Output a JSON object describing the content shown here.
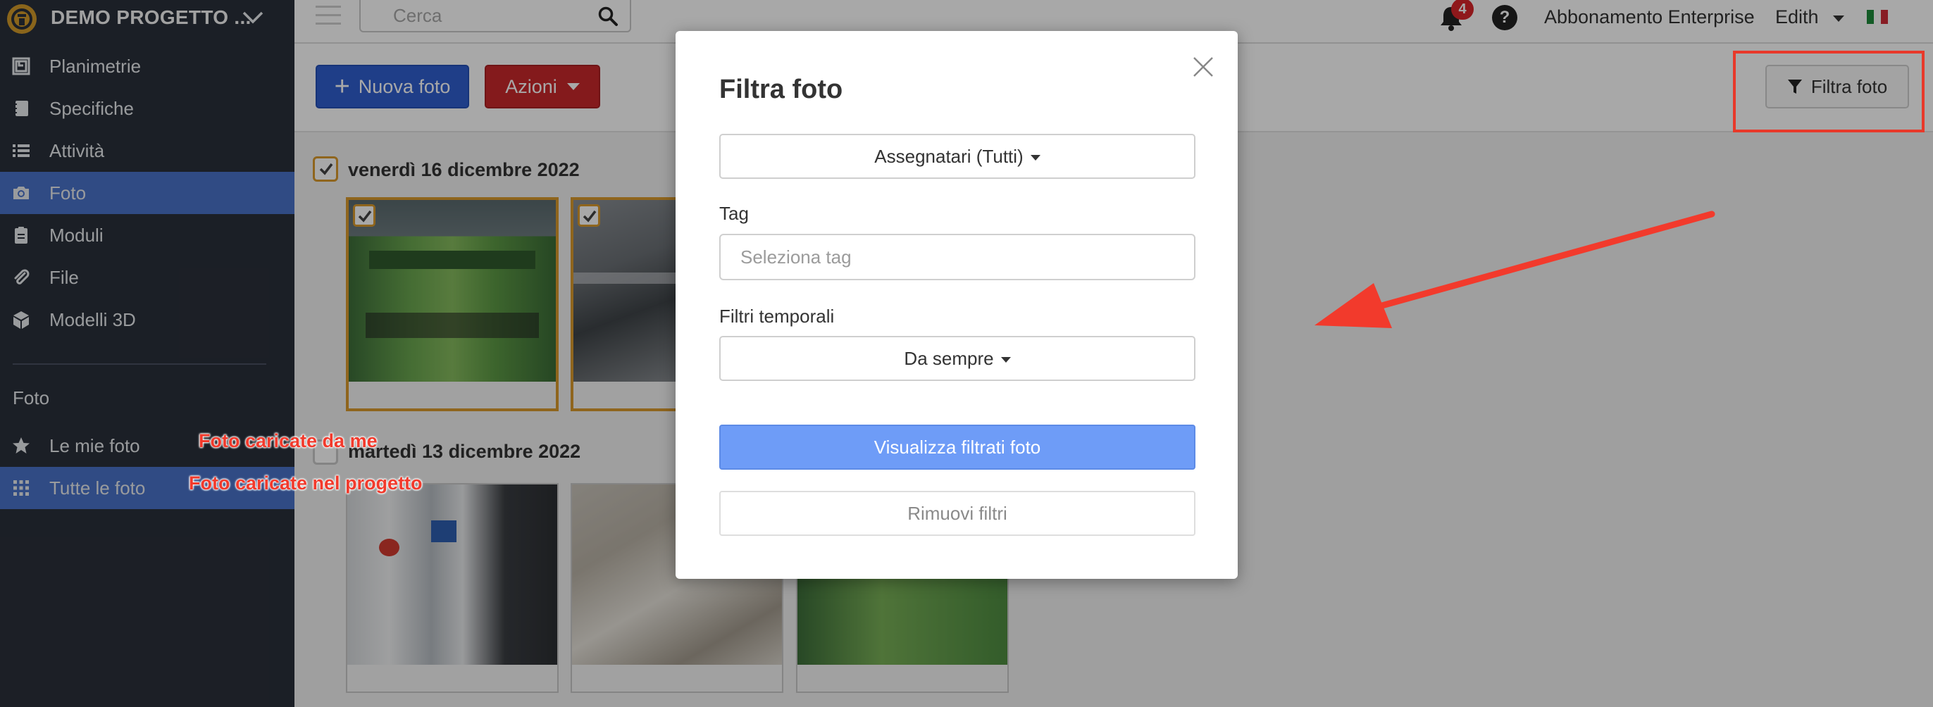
{
  "sidebar": {
    "project_title": "DEMO PROGETTO ...",
    "items": [
      {
        "label": "Planimetrie",
        "icon": "floorplan-icon"
      },
      {
        "label": "Specifiche",
        "icon": "notebook-icon"
      },
      {
        "label": "Attività",
        "icon": "list-icon"
      },
      {
        "label": "Foto",
        "icon": "camera-icon",
        "active": true
      },
      {
        "label": "Moduli",
        "icon": "clipboard-icon"
      },
      {
        "label": "File",
        "icon": "paperclip-icon"
      },
      {
        "label": "Modelli 3D",
        "icon": "cube-icon"
      }
    ],
    "section_title": "Foto",
    "sub_items": [
      {
        "label": "Le mie foto",
        "icon": "star-icon"
      },
      {
        "label": "Tutte le foto",
        "icon": "grid-icon",
        "active": true
      }
    ]
  },
  "topbar": {
    "search_placeholder": "Cerca",
    "notifications_count": "4",
    "help_label": "?",
    "plan_label": "Abbonamento Enterprise",
    "user_name": "Edith",
    "language_flag": "flag-italy-icon"
  },
  "toolbar": {
    "new_photo_label": "Nuova foto",
    "actions_label": "Azioni",
    "filter_label": "Filtra foto"
  },
  "groups": [
    {
      "date": "venerdì 16 dicembre 2022"
    },
    {
      "date": "martedì 13 dicembre 2022"
    }
  ],
  "modal": {
    "title": "Filtra foto",
    "assignees_label": "Assegnatari (Tutti)",
    "tag_label": "Tag",
    "tag_placeholder": "Seleziona tag",
    "time_filters_label": "Filtri temporali",
    "time_filter_value": "Da sempre",
    "apply_label": "Visualizza filtrati foto",
    "remove_label": "Rimuovi filtri"
  },
  "annotations": {
    "my_photos": "Foto caricate da me",
    "all_photos": "Foto caricate nel progetto"
  },
  "colors": {
    "sidebar_bg": "#2a2f3a",
    "active_nav": "#4a72c9",
    "primary_button": "#2f5ecf",
    "danger_button": "#c9282b",
    "selection": "#d99a2c",
    "annotation_red": "#f23a2c"
  }
}
